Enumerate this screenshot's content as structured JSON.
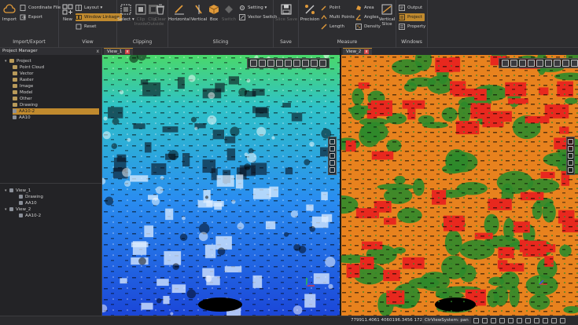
{
  "ribbon": {
    "import_export": {
      "label": "Import/Export",
      "import": "Import",
      "coordinate_file": "Coordinate File",
      "export": "Export"
    },
    "view": {
      "label": "View",
      "new": "New",
      "layout": "Layout",
      "window_linkage": "Window Linkage",
      "reset": "Reset"
    },
    "clipping": {
      "label": "Clipping",
      "select": "Select",
      "clip_inside": "Clip Inside",
      "clip_outside": "Clip Outside",
      "clear": "Clear"
    },
    "slicing": {
      "label": "Slicing",
      "horizontal": "Horizontal",
      "vertical": "Vertical",
      "box": "Box",
      "switch": "Switch",
      "setting": "Setting",
      "vector_switch": "Vector Switch"
    },
    "save": {
      "label": "Save",
      "slice_save": "Slice Save"
    },
    "measure": {
      "label": "Measure",
      "precision": "Precision",
      "point": "Point",
      "multi_points": "Multi Points",
      "length": "Length",
      "area": "Area",
      "angles": "Angles",
      "density": "Density",
      "vertical_slice": "Vertical Slice"
    },
    "windows": {
      "label": "Windows",
      "output": "Output",
      "project": "Project",
      "property": "Property"
    }
  },
  "project_manager": {
    "title": "Project Manager",
    "close": "x",
    "tree": [
      {
        "label": "Project",
        "level": 0,
        "kind": "root"
      },
      {
        "label": "Point Cloud",
        "level": 1,
        "kind": "folder"
      },
      {
        "label": "Vector",
        "level": 1,
        "kind": "folder"
      },
      {
        "label": "Raster",
        "level": 1,
        "kind": "folder"
      },
      {
        "label": "Image",
        "level": 1,
        "kind": "folder"
      },
      {
        "label": "Model",
        "level": 1,
        "kind": "folder"
      },
      {
        "label": "Other",
        "level": 1,
        "kind": "folder"
      },
      {
        "label": "Drawing",
        "level": 1,
        "kind": "folder"
      },
      {
        "label": "AA10-2",
        "level": 1,
        "kind": "leaf",
        "selected": true
      },
      {
        "label": "AA10",
        "level": 1,
        "kind": "leaf"
      }
    ],
    "views_tree": [
      {
        "label": "View_1",
        "level": 0
      },
      {
        "label": "Drawing",
        "level": 1
      },
      {
        "label": "AA10",
        "level": 1
      },
      {
        "label": "View_2",
        "level": 0
      },
      {
        "label": "AA10-2",
        "level": 1
      }
    ]
  },
  "views": {
    "view1": {
      "tab": "View_1",
      "close": "x"
    },
    "view2": {
      "tab": "View_2",
      "close": "x"
    }
  },
  "status": {
    "coords": "779911.4061 4060196.3456 172.2804",
    "view_system": "CtrViewSystem: pan"
  },
  "colors": {
    "accent": "#c08a2e",
    "elevation_low": "#1f5fe0",
    "elevation_high": "#35e060",
    "class_building": "#e8281e",
    "class_vegetation": "#2d8a2a",
    "class_ground": "#e8821e"
  }
}
